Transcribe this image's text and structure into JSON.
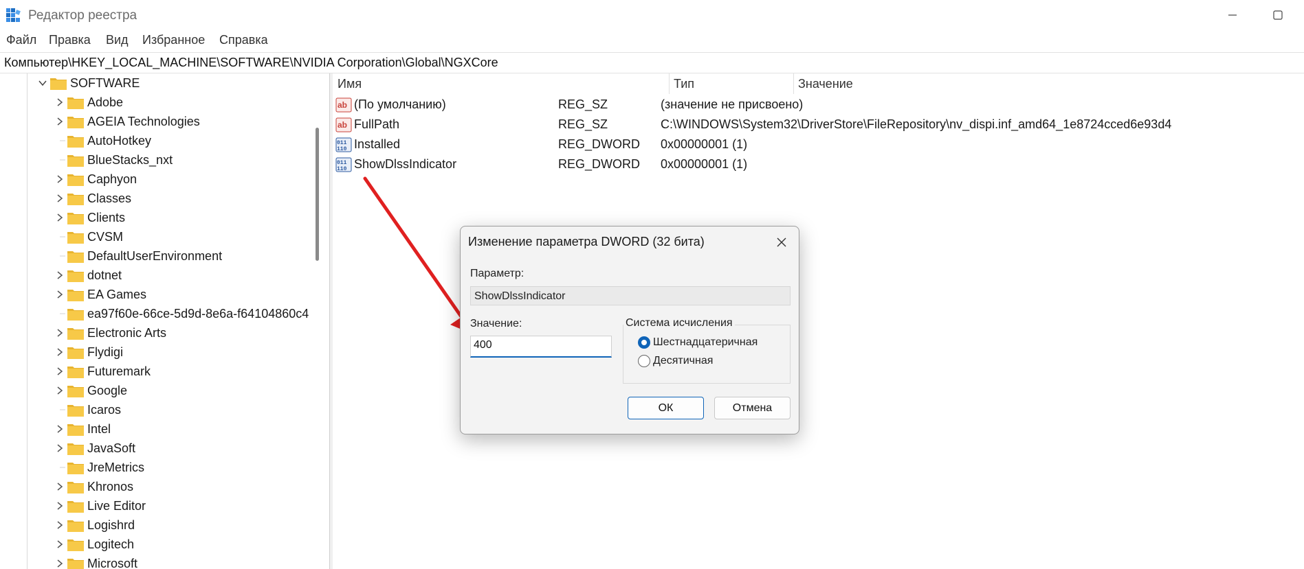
{
  "window": {
    "title": "Редактор реестра"
  },
  "menu": [
    "Файл",
    "Правка",
    "Вид",
    "Избранное",
    "Справка"
  ],
  "address": "Компьютер\\HKEY_LOCAL_MACHINE\\SOFTWARE\\NVIDIA Corporation\\Global\\NGXCore",
  "tree": {
    "root": {
      "label": "SOFTWARE",
      "expanded": true
    },
    "items": [
      {
        "label": "Adobe",
        "has_children": true
      },
      {
        "label": "AGEIA Technologies",
        "has_children": true
      },
      {
        "label": "AutoHotkey",
        "has_children": false
      },
      {
        "label": "BlueStacks_nxt",
        "has_children": false
      },
      {
        "label": "Caphyon",
        "has_children": true
      },
      {
        "label": "Classes",
        "has_children": true
      },
      {
        "label": "Clients",
        "has_children": true
      },
      {
        "label": "CVSM",
        "has_children": false
      },
      {
        "label": "DefaultUserEnvironment",
        "has_children": false
      },
      {
        "label": "dotnet",
        "has_children": true
      },
      {
        "label": "EA Games",
        "has_children": true
      },
      {
        "label": "ea97f60e-66ce-5d9d-8e6a-f64104860c4",
        "has_children": false
      },
      {
        "label": "Electronic Arts",
        "has_children": true
      },
      {
        "label": "Flydigi",
        "has_children": true
      },
      {
        "label": "Futuremark",
        "has_children": true
      },
      {
        "label": "Google",
        "has_children": true
      },
      {
        "label": "Icaros",
        "has_children": false
      },
      {
        "label": "Intel",
        "has_children": true
      },
      {
        "label": "JavaSoft",
        "has_children": true
      },
      {
        "label": "JreMetrics",
        "has_children": false
      },
      {
        "label": "Khronos",
        "has_children": true
      },
      {
        "label": "Live Editor",
        "has_children": true
      },
      {
        "label": "Logishrd",
        "has_children": true
      },
      {
        "label": "Logitech",
        "has_children": true
      },
      {
        "label": "Microsoft",
        "has_children": true
      }
    ]
  },
  "values": {
    "headers": {
      "name": "Имя",
      "type": "Тип",
      "data": "Значение"
    },
    "rows": [
      {
        "icon": "string-value-icon",
        "name": "(По умолчанию)",
        "type": "REG_SZ",
        "data": "(значение не присвоено)"
      },
      {
        "icon": "string-value-icon",
        "name": "FullPath",
        "type": "REG_SZ",
        "data": "C:\\WINDOWS\\System32\\DriverStore\\FileRepository\\nv_dispi.inf_amd64_1e8724cced6e93d4"
      },
      {
        "icon": "binary-value-icon",
        "name": "Installed",
        "type": "REG_DWORD",
        "data": "0x00000001 (1)"
      },
      {
        "icon": "binary-value-icon",
        "name": "ShowDlssIndicator",
        "type": "REG_DWORD",
        "data": "0x00000001 (1)"
      }
    ]
  },
  "dialog": {
    "title": "Изменение параметра DWORD (32 бита)",
    "param_label": "Параметр:",
    "param_value": "ShowDlssIndicator",
    "value_label": "Значение:",
    "value": "400",
    "base_title": "Система исчисления",
    "radio_hex": "Шестнадцатеричная",
    "radio_dec": "Десятичная",
    "selected_base": "hex",
    "ok": "ОК",
    "cancel": "Отмена"
  },
  "colors": {
    "folder": "#f7c948",
    "accent": "#0f64b8",
    "arrow": "#e02020",
    "string_icon": "#c8423a",
    "binary_icon": "#2c5aa0"
  }
}
